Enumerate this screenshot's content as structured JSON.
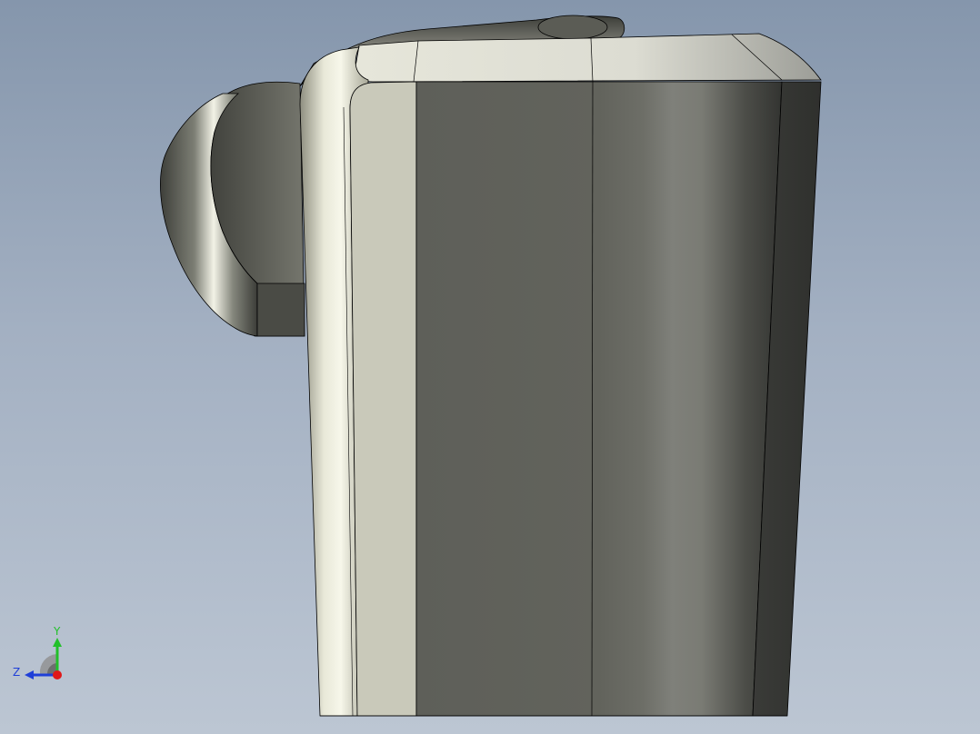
{
  "viewport": {
    "background_top": "#8596ac",
    "background_bottom": "#bcc6d3"
  },
  "model": {
    "edge_color": "#000000",
    "shade_light": "#c9c9ba",
    "shade_dark": "#5f605a"
  },
  "triad": {
    "y_label": "Y",
    "z_label": "Z",
    "y_color": "#22c02a",
    "z_color": "#1f3fd8",
    "x_color": "#e01818"
  }
}
